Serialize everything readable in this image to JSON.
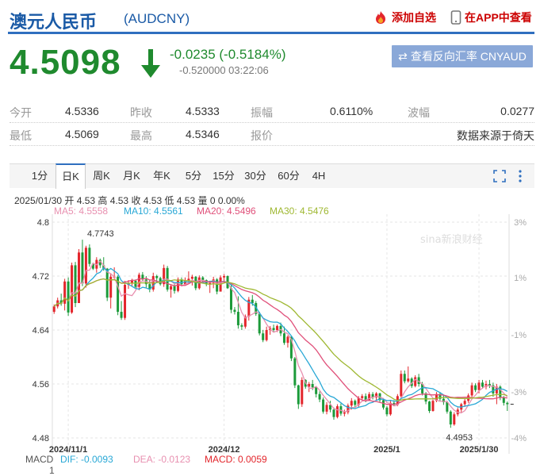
{
  "header": {
    "title": "澳元人民币",
    "code": "(AUDCNY)",
    "add_watch": "添加自选",
    "app_view": "在APP中查看"
  },
  "quote": {
    "price": "4.5098",
    "change": "-0.0235 (-0.5184%)",
    "sub": "-0.520000 03:22:06",
    "reverse_btn": "查看反向汇率 CNYAUD"
  },
  "stats": {
    "open_label": "今开",
    "open": "4.5336",
    "prev_label": "昨收",
    "prev": "4.5333",
    "amp_label": "振幅",
    "amp": "0.6110%",
    "wave_label": "波幅",
    "wave": "0.0277",
    "low_label": "最低",
    "low": "4.5069",
    "high_label": "最高",
    "high": "4.5346",
    "quote_label": "报价",
    "source": "数据来源于倚天"
  },
  "tabs": [
    "1分",
    "日K",
    "周K",
    "月K",
    "年K",
    "5分",
    "15分",
    "30分",
    "60分",
    "4H"
  ],
  "active_tab": "日K",
  "candle_info": "2025/01/30 开 4.53 高 4.53 收 4.53 低 4.53 量 0 0.00%",
  "ma": {
    "ma5": "MA5: 4.5558",
    "ma10": "MA10: 4.5561",
    "ma20": "MA20: 4.5496",
    "ma30": "MA30: 4.5476"
  },
  "macd": {
    "label": "MACD",
    "dif": "DIF: -0.0093",
    "dea": "DEA: -0.0123",
    "macd": "MACD: 0.0059",
    "axis_val": "1"
  },
  "colors": {
    "up": "#e3262c",
    "down": "#1c9a3a",
    "ma5": "#e890b0",
    "ma10": "#29a8d6",
    "ma20": "#e0507a",
    "ma30": "#9fb832",
    "blue": "#1a5aa6"
  },
  "chart_data": {
    "type": "candlestick",
    "y_ticks": [
      "4.8",
      "4.72",
      "4.64",
      "4.56",
      "4.48"
    ],
    "y_values": [
      4.8,
      4.72,
      4.64,
      4.56,
      4.48
    ],
    "pct_ticks": [
      "3%",
      "1%",
      "-1%",
      "-3%",
      "-4%"
    ],
    "x_ticks": [
      "2024/11/1",
      "2024/12",
      "2025/1",
      "2025/1/30"
    ],
    "x_tick_index": [
      4,
      48,
      94,
      120
    ],
    "max_label": "4.7743",
    "max_index": 8,
    "max_value": 4.7743,
    "min_label": "4.4953",
    "min_index": 112,
    "min_value": 4.4953,
    "watermark": "sina新浪财经",
    "candles": [
      [
        4.667,
        4.678,
        4.664,
        4.675
      ],
      [
        4.675,
        4.688,
        4.672,
        4.684
      ],
      [
        4.684,
        4.694,
        4.676,
        4.679
      ],
      [
        4.679,
        4.716,
        4.669,
        4.712
      ],
      [
        4.712,
        4.718,
        4.661,
        4.666
      ],
      [
        4.666,
        4.74,
        4.664,
        4.736
      ],
      [
        4.736,
        4.741,
        4.674,
        4.68
      ],
      [
        4.68,
        4.76,
        4.68,
        4.755
      ],
      [
        4.755,
        4.774,
        4.705,
        4.709
      ],
      [
        4.709,
        4.765,
        4.703,
        4.762
      ],
      [
        4.762,
        4.767,
        4.734,
        4.738
      ],
      [
        4.738,
        4.74,
        4.729,
        4.731
      ],
      [
        4.731,
        4.748,
        4.725,
        4.744
      ],
      [
        4.744,
        4.746,
        4.732,
        4.736
      ],
      [
        4.736,
        4.748,
        4.728,
        4.731
      ],
      [
        4.731,
        4.732,
        4.683,
        4.688
      ],
      [
        4.688,
        4.723,
        4.672,
        4.719
      ],
      [
        4.719,
        4.733,
        4.716,
        4.719
      ],
      [
        4.719,
        4.721,
        4.662,
        4.667
      ],
      [
        4.667,
        4.683,
        4.655,
        4.658
      ],
      [
        4.658,
        4.713,
        4.655,
        4.707
      ],
      [
        4.707,
        4.714,
        4.701,
        4.71
      ],
      [
        4.71,
        4.716,
        4.705,
        4.713
      ],
      [
        4.713,
        4.715,
        4.702,
        4.704
      ],
      [
        4.704,
        4.725,
        4.699,
        4.722
      ],
      [
        4.722,
        4.726,
        4.713,
        4.715
      ],
      [
        4.715,
        4.72,
        4.703,
        4.708
      ],
      [
        4.708,
        4.715,
        4.696,
        4.7
      ],
      [
        4.7,
        4.725,
        4.697,
        4.72
      ],
      [
        4.72,
        4.722,
        4.711,
        4.717
      ],
      [
        4.717,
        4.719,
        4.706,
        4.708
      ],
      [
        4.708,
        4.737,
        4.704,
        4.732
      ],
      [
        4.732,
        4.735,
        4.697,
        4.7
      ],
      [
        4.7,
        4.708,
        4.688,
        4.705
      ],
      [
        4.705,
        4.708,
        4.694,
        4.698
      ],
      [
        4.698,
        4.718,
        4.696,
        4.715
      ],
      [
        4.715,
        4.718,
        4.705,
        4.708
      ],
      [
        4.708,
        4.718,
        4.707,
        4.713
      ],
      [
        4.713,
        4.727,
        4.71,
        4.716
      ],
      [
        4.716,
        4.722,
        4.706,
        4.719
      ],
      [
        4.719,
        4.72,
        4.699,
        4.702
      ],
      [
        4.702,
        4.721,
        4.7,
        4.718
      ],
      [
        4.718,
        4.72,
        4.71,
        4.714
      ],
      [
        4.714,
        4.715,
        4.705,
        4.708
      ],
      [
        4.708,
        4.713,
        4.695,
        4.71
      ],
      [
        4.71,
        4.719,
        4.702,
        4.715
      ],
      [
        4.715,
        4.717,
        4.693,
        4.697
      ],
      [
        4.697,
        4.721,
        4.697,
        4.718
      ],
      [
        4.718,
        4.723,
        4.709,
        4.72
      ],
      [
        4.72,
        4.721,
        4.701,
        4.702
      ],
      [
        4.702,
        4.708,
        4.665,
        4.67
      ],
      [
        4.67,
        4.674,
        4.663,
        4.667
      ],
      [
        4.667,
        4.69,
        4.642,
        4.647
      ],
      [
        4.647,
        4.65,
        4.64,
        4.645
      ],
      [
        4.645,
        4.663,
        4.642,
        4.66
      ],
      [
        4.66,
        4.689,
        4.654,
        4.685
      ],
      [
        4.685,
        4.692,
        4.676,
        4.68
      ],
      [
        4.68,
        4.683,
        4.661,
        4.664
      ],
      [
        4.664,
        4.667,
        4.632,
        4.635
      ],
      [
        4.635,
        4.64,
        4.622,
        4.625
      ],
      [
        4.625,
        4.645,
        4.623,
        4.64
      ],
      [
        4.64,
        4.646,
        4.633,
        4.643
      ],
      [
        4.643,
        4.648,
        4.637,
        4.64
      ],
      [
        4.64,
        4.648,
        4.637,
        4.646
      ],
      [
        4.646,
        4.651,
        4.631,
        4.635
      ],
      [
        4.635,
        4.645,
        4.618,
        4.621
      ],
      [
        4.621,
        4.632,
        4.614,
        4.63
      ],
      [
        4.63,
        4.631,
        4.594,
        4.598
      ],
      [
        4.598,
        4.6,
        4.554,
        4.558
      ],
      [
        4.558,
        4.559,
        4.523,
        4.53
      ],
      [
        4.53,
        4.57,
        4.526,
        4.566
      ],
      [
        4.566,
        4.567,
        4.553,
        4.556
      ],
      [
        4.556,
        4.563,
        4.548,
        4.56
      ],
      [
        4.56,
        4.566,
        4.551,
        4.555
      ],
      [
        4.555,
        4.557,
        4.54,
        4.545
      ],
      [
        4.545,
        4.549,
        4.533,
        4.537
      ],
      [
        4.537,
        4.54,
        4.516,
        4.519
      ],
      [
        4.519,
        4.533,
        4.515,
        4.529
      ],
      [
        4.529,
        4.535,
        4.518,
        4.522
      ],
      [
        4.522,
        4.525,
        4.507,
        4.511
      ],
      [
        4.511,
        4.53,
        4.509,
        4.527
      ],
      [
        4.527,
        4.531,
        4.513,
        4.516
      ],
      [
        4.516,
        4.522,
        4.512,
        4.518
      ],
      [
        4.518,
        4.531,
        4.515,
        4.528
      ],
      [
        4.528,
        4.539,
        4.522,
        4.535
      ],
      [
        4.535,
        4.537,
        4.525,
        4.529
      ],
      [
        4.529,
        4.542,
        4.525,
        4.539
      ],
      [
        4.539,
        4.545,
        4.536,
        4.542
      ],
      [
        4.542,
        4.546,
        4.533,
        4.536
      ],
      [
        4.536,
        4.548,
        4.535,
        4.545
      ],
      [
        4.545,
        4.548,
        4.537,
        4.54
      ],
      [
        4.54,
        4.548,
        4.536,
        4.546
      ],
      [
        4.546,
        4.547,
        4.533,
        4.536
      ],
      [
        4.536,
        4.539,
        4.522,
        4.525
      ],
      [
        4.525,
        4.527,
        4.512,
        4.515
      ],
      [
        4.515,
        4.535,
        4.513,
        4.532
      ],
      [
        4.532,
        4.536,
        4.527,
        4.529
      ],
      [
        4.529,
        4.545,
        4.527,
        4.542
      ],
      [
        4.542,
        4.58,
        4.54,
        4.575
      ],
      [
        4.575,
        4.58,
        4.561,
        4.564
      ],
      [
        4.564,
        4.586,
        4.562,
        4.568
      ],
      [
        4.568,
        4.57,
        4.554,
        4.557
      ],
      [
        4.557,
        4.573,
        4.555,
        4.57
      ],
      [
        4.57,
        4.575,
        4.556,
        4.56
      ],
      [
        4.56,
        4.563,
        4.543,
        4.546
      ],
      [
        4.546,
        4.548,
        4.53,
        4.534
      ],
      [
        4.534,
        4.535,
        4.517,
        4.52
      ],
      [
        4.52,
        4.537,
        4.519,
        4.535
      ],
      [
        4.535,
        4.548,
        4.533,
        4.545
      ],
      [
        4.545,
        4.548,
        4.535,
        4.538
      ],
      [
        4.538,
        4.544,
        4.529,
        4.533
      ],
      [
        4.533,
        4.535,
        4.516,
        4.519
      ],
      [
        4.519,
        4.521,
        4.495,
        4.5
      ],
      [
        4.5,
        4.518,
        4.498,
        4.515
      ],
      [
        4.515,
        4.525,
        4.512,
        4.522
      ],
      [
        4.522,
        4.532,
        4.518,
        4.53
      ],
      [
        4.53,
        4.538,
        4.526,
        4.535
      ],
      [
        4.535,
        4.546,
        4.532,
        4.543
      ],
      [
        4.543,
        4.562,
        4.54,
        4.558
      ],
      [
        4.558,
        4.561,
        4.548,
        4.551
      ],
      [
        4.551,
        4.566,
        4.546,
        4.562
      ],
      [
        4.562,
        4.566,
        4.553,
        4.556
      ],
      [
        4.556,
        4.565,
        4.552,
        4.56
      ],
      [
        4.56,
        4.566,
        4.554,
        4.558
      ],
      [
        4.558,
        4.562,
        4.541,
        4.546
      ],
      [
        4.546,
        4.56,
        4.53,
        4.556
      ],
      [
        4.556,
        4.558,
        4.536,
        4.54
      ],
      [
        4.54,
        4.542,
        4.528,
        4.532
      ],
      [
        4.532,
        4.534,
        4.52,
        4.53
      ]
    ]
  }
}
